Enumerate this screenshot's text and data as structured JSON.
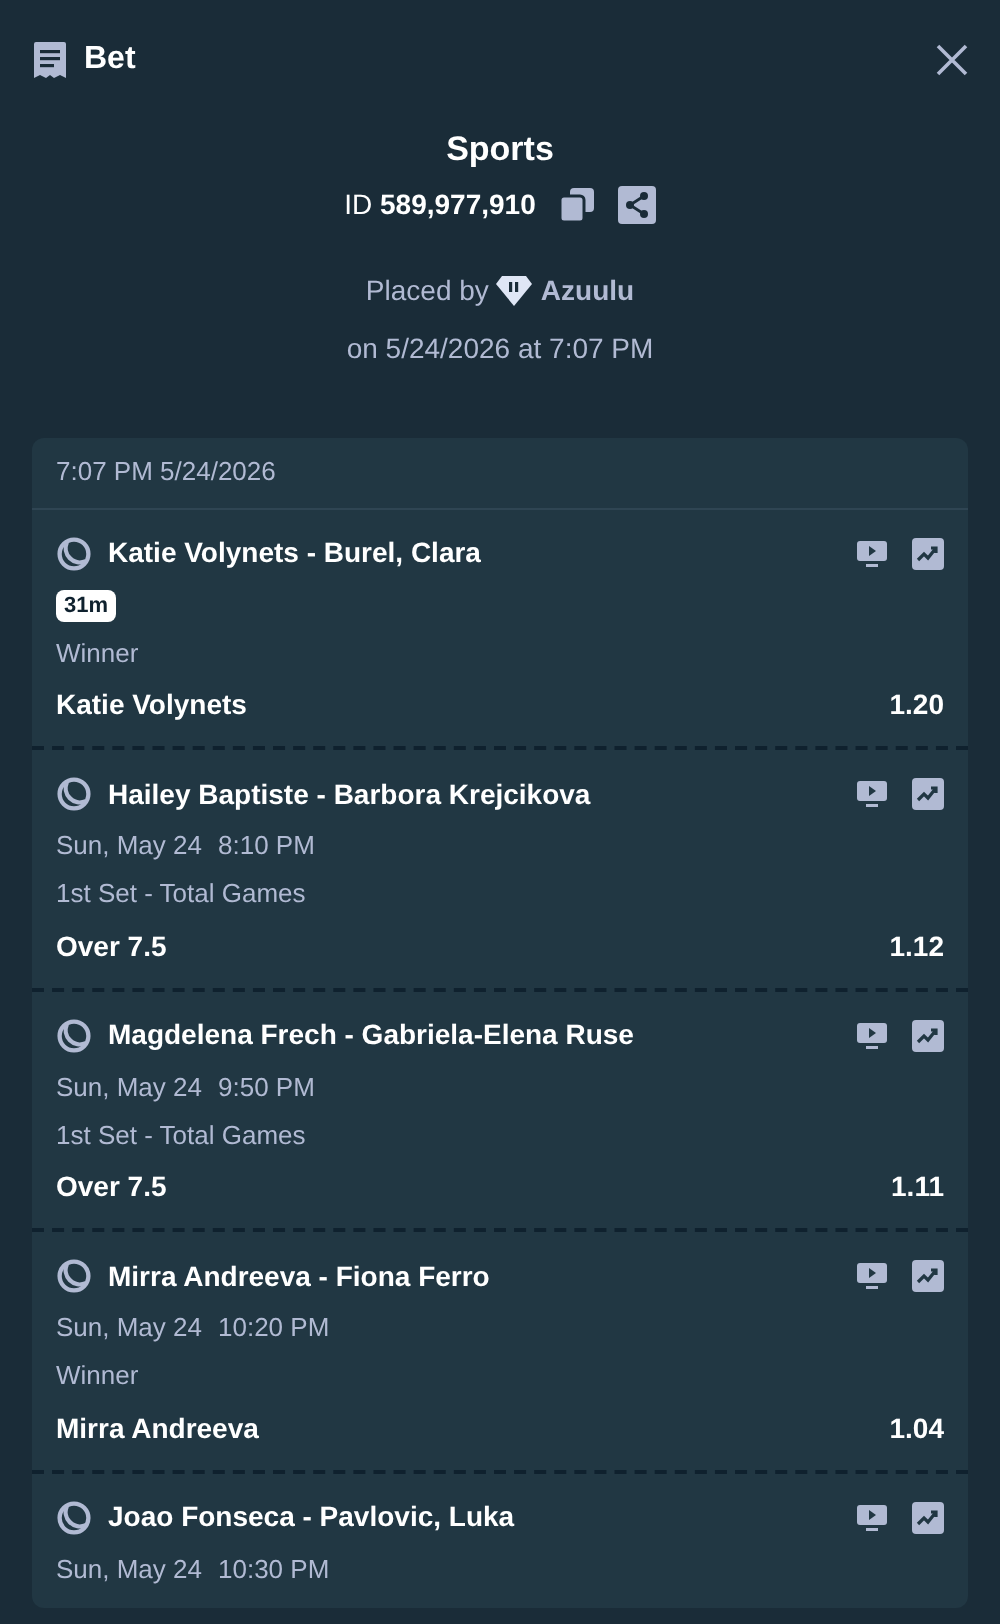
{
  "header": {
    "title": "Bet"
  },
  "summary": {
    "category": "Sports",
    "id_label": "ID",
    "id_value": "589,977,910",
    "placed_by_label": "Placed by",
    "user": "Azuulu",
    "placed_on": "on 5/24/2026 at 7:07 PM"
  },
  "card": {
    "timestamp": "7:07 PM 5/24/2026",
    "legs": [
      {
        "kind": "live",
        "event": "Katie Volynets - Burel, Clara",
        "badge": "31m",
        "market": "Winner",
        "selection": "Katie Volynets",
        "odds": "1.20"
      },
      {
        "kind": "scheduled",
        "event": "Hailey Baptiste - Barbora Krejcikova",
        "date": "Sun, May 24",
        "time": "8:10 PM",
        "market": "1st Set - Total Games",
        "selection": "Over 7.5",
        "odds": "1.12"
      },
      {
        "kind": "scheduled",
        "event": "Magdelena Frech - Gabriela-Elena Ruse",
        "date": "Sun, May 24",
        "time": "9:50 PM",
        "market": "1st Set - Total Games",
        "selection": "Over 7.5",
        "odds": "1.11"
      },
      {
        "kind": "scheduled",
        "event": "Mirra Andreeva - Fiona Ferro",
        "date": "Sun, May 24",
        "time": "10:20 PM",
        "market": "Winner",
        "selection": "Mirra Andreeva",
        "odds": "1.04"
      },
      {
        "kind": "scheduled",
        "event": "Joao Fonseca - Pavlovic, Luka",
        "date": "Sun, May 24",
        "time": "10:30 PM"
      }
    ]
  }
}
